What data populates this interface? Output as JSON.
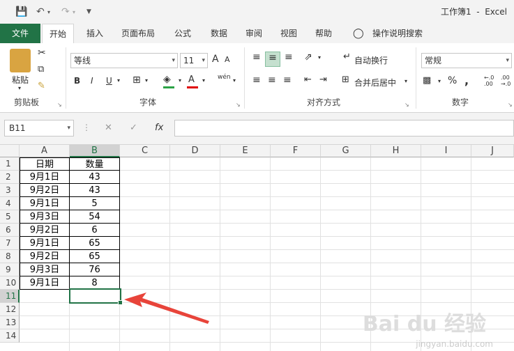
{
  "app": {
    "title": "工作簿1  -  Excel"
  },
  "tabs": [
    "文件",
    "开始",
    "插入",
    "页面布局",
    "公式",
    "数据",
    "审阅",
    "视图",
    "帮助",
    "操作说明搜索"
  ],
  "ribbon": {
    "clipboard": {
      "paste": "粘贴",
      "label": "剪贴板"
    },
    "font": {
      "name": "等线",
      "size": "11",
      "label": "字体",
      "bold": "B",
      "italic": "I",
      "underline": "U",
      "grow": "A",
      "shrink": "A",
      "color_letter": "A",
      "phonetic": "wén"
    },
    "alignment": {
      "wrap": "自动换行",
      "merge": "合并后居中",
      "label": "对齐方式"
    },
    "number": {
      "format": "常规",
      "percent": "%",
      "comma": ",",
      "label": "数字"
    }
  },
  "formula_bar": {
    "name_box": "B11",
    "fx": "fx",
    "value": ""
  },
  "columns": [
    "A",
    "B",
    "C",
    "D",
    "E",
    "F",
    "G",
    "H",
    "I",
    "J"
  ],
  "rows": [
    "1",
    "2",
    "3",
    "4",
    "5",
    "6",
    "7",
    "8",
    "9",
    "10",
    "11",
    "12",
    "13",
    "14"
  ],
  "table": {
    "headers": [
      "日期",
      "数量"
    ],
    "data": [
      [
        "9月1日",
        "43"
      ],
      [
        "9月2日",
        "43"
      ],
      [
        "9月1日",
        "5"
      ],
      [
        "9月3日",
        "54"
      ],
      [
        "9月2日",
        "6"
      ],
      [
        "9月1日",
        "65"
      ],
      [
        "9月2日",
        "65"
      ],
      [
        "9月3日",
        "76"
      ],
      [
        "9月1日",
        "8"
      ]
    ]
  },
  "selected_cell": "B11",
  "colors": {
    "accent": "#217346",
    "arrow": "#e8443a"
  },
  "watermark": {
    "brand": "Bai du 经验",
    "url": "jingyan.baidu.com"
  }
}
